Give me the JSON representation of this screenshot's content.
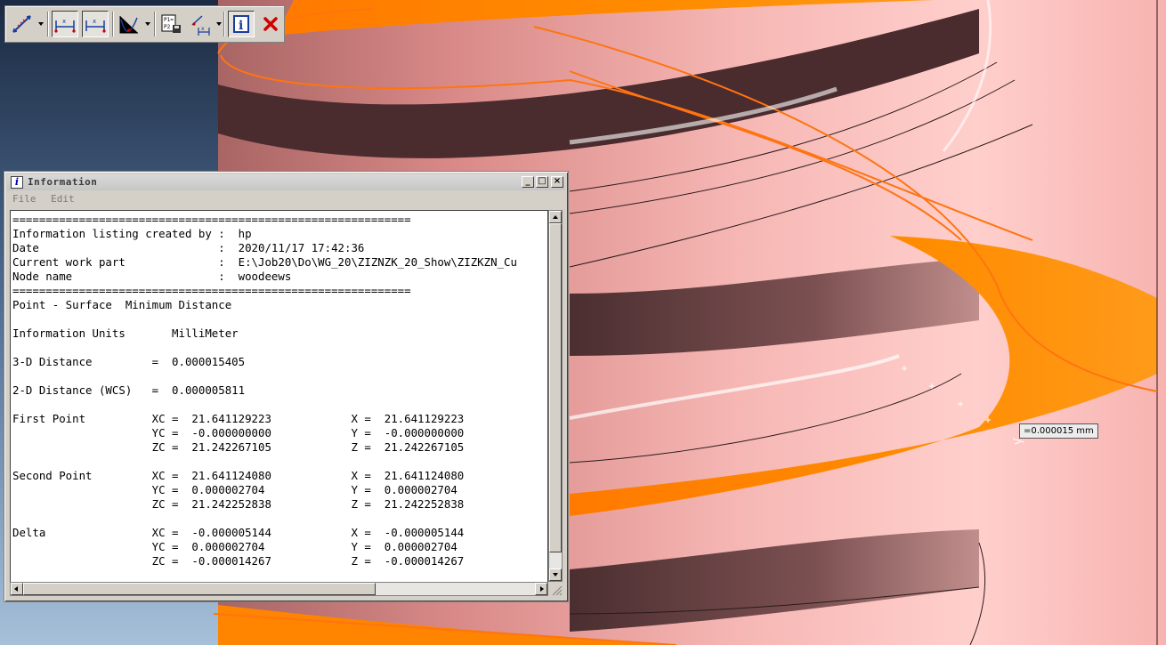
{
  "toolbar": {
    "buttons": [
      {
        "name": "measure-distance-icon"
      },
      {
        "name": "dimension-horizontal-icon"
      },
      {
        "name": "dimension-horizontal-alt-icon"
      },
      {
        "name": "curve-analysis-icon"
      },
      {
        "name": "point-to-point-icon"
      },
      {
        "name": "angle-measure-icon"
      },
      {
        "name": "info-icon"
      },
      {
        "name": "close-red-x-icon"
      }
    ]
  },
  "window": {
    "title": "Information",
    "menus": [
      "File",
      "Edit"
    ],
    "listing": [
      "============================================================",
      "Information listing created by :  hp",
      "Date                           :  2020/11/17 17:42:36",
      "Current work part              :  E:\\Job20\\Do\\WG_20\\ZIZNZK_20_Show\\ZIZKZN_Cu",
      "Node name                      :  woodeews",
      "============================================================",
      "Point - Surface  Minimum Distance",
      "",
      "Information Units       MilliMeter",
      "",
      "3-D Distance         =  0.000015405",
      "",
      "2-D Distance (WCS)   =  0.000005811",
      "",
      "First Point          XC =  21.641129223            X =  21.641129223",
      "                     YC =  -0.000000000            Y =  -0.000000000",
      "                     ZC =  21.242267105            Z =  21.242267105",
      "",
      "Second Point         XC =  21.641124080            X =  21.641124080",
      "                     YC =  0.000002704             Y =  0.000002704",
      "                     ZC =  21.242252838            Z =  21.242252838",
      "",
      "Delta                XC =  -0.000005144            X =  -0.000005144",
      "                     YC =  0.000002704             Y =  0.000002704",
      "                     ZC =  -0.000014267            Z =  -0.000014267"
    ]
  },
  "viewport": {
    "measurement_label": "=0.000015 mm",
    "colors": {
      "background_top": "#1c2c44",
      "background_bottom": "#a3bdd6",
      "part_surface": "#f4b0ad",
      "part_shadow": "#4a2c2e",
      "selected_face": "#ff8000",
      "edge_curve": "#ff7410"
    }
  }
}
